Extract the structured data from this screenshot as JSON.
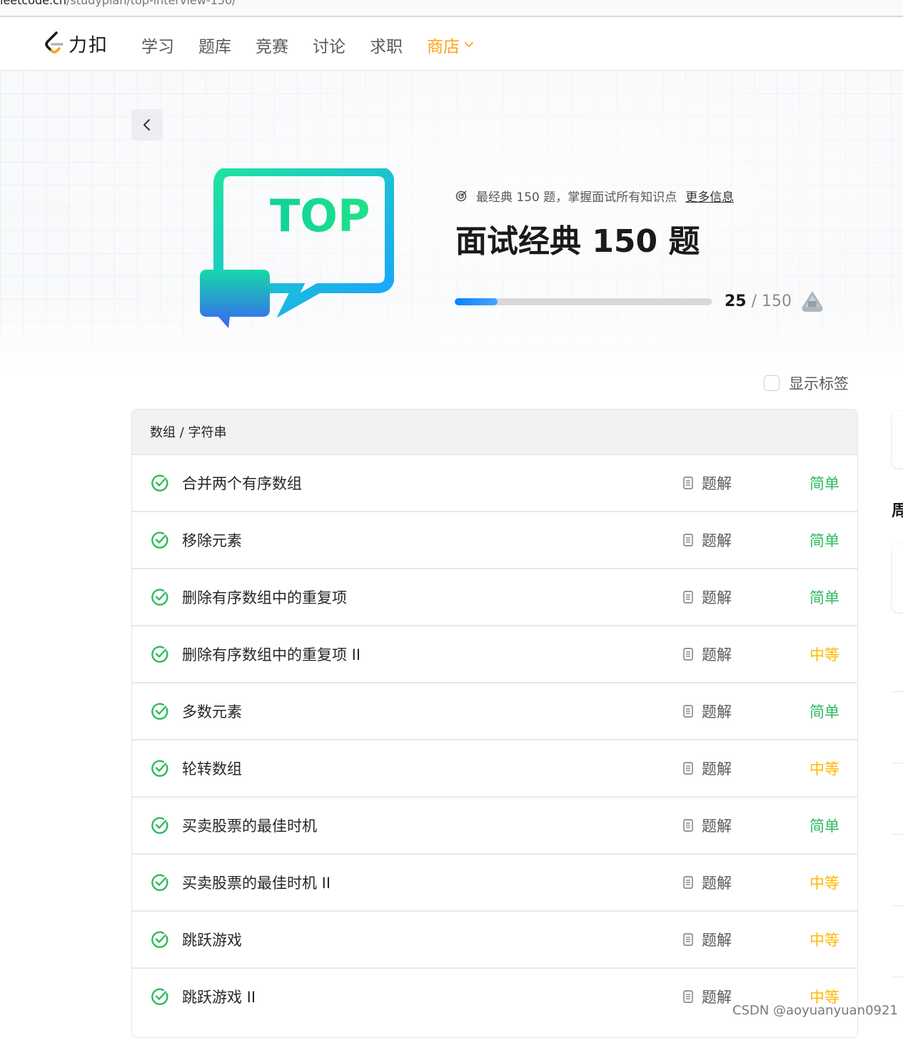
{
  "browser": {
    "url_host": "leetcode.cn",
    "url_path": "/studyplan/top-interview-150/"
  },
  "nav": {
    "logo_text": "力扣",
    "items": [
      {
        "label": "学习"
      },
      {
        "label": "题库"
      },
      {
        "label": "竞赛"
      },
      {
        "label": "讨论"
      },
      {
        "label": "求职"
      }
    ],
    "shop_label": "商店",
    "shop_color": "#ffa116"
  },
  "plan": {
    "tagline": "最经典 150 题，掌握面试所有知识点",
    "more_info": "更多信息",
    "title": "面试经典 150 题",
    "graphic_text": "TOP",
    "progress": {
      "done": "25",
      "separator": "/",
      "total": "150",
      "fraction": 0.167
    }
  },
  "show_tags": {
    "label": "显示标签",
    "checked": false
  },
  "section": {
    "header": "数组 / 字符串",
    "solution_label": "题解",
    "problems": [
      {
        "title": "合并两个有序数组",
        "difficulty": "简单",
        "level": "easy"
      },
      {
        "title": "移除元素",
        "difficulty": "简单",
        "level": "easy"
      },
      {
        "title": "删除有序数组中的重复项",
        "difficulty": "简单",
        "level": "easy"
      },
      {
        "title": "删除有序数组中的重复项 II",
        "difficulty": "中等",
        "level": "medium"
      },
      {
        "title": "多数元素",
        "difficulty": "简单",
        "level": "easy"
      },
      {
        "title": "轮转数组",
        "difficulty": "中等",
        "level": "medium"
      },
      {
        "title": "买卖股票的最佳时机",
        "difficulty": "简单",
        "level": "easy"
      },
      {
        "title": "买卖股票的最佳时机 II",
        "difficulty": "中等",
        "level": "medium"
      },
      {
        "title": "跳跃游戏",
        "difficulty": "中等",
        "level": "medium"
      },
      {
        "title": "跳跃游戏 II",
        "difficulty": "中等",
        "level": "medium"
      }
    ]
  },
  "side_panel": {
    "title_partial": "周"
  },
  "colors": {
    "easy": "#2cbb5d",
    "medium": "#ffb800",
    "check": "#2cbb5d",
    "progress": "#0a84ff"
  },
  "icons": {
    "back": "chevron-left-icon",
    "tagline": "target-icon",
    "solution": "document-icon",
    "status": "check-circle-icon",
    "badge": "medal-icon"
  },
  "watermark": "CSDN @aoyuanyuan0921"
}
